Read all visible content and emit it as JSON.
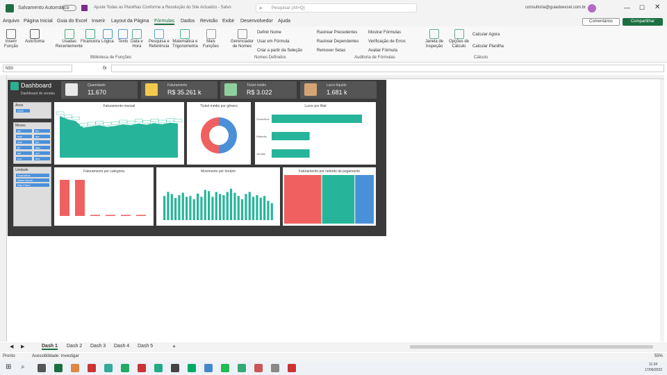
{
  "titlebar": {
    "autosave": "Salvamento Automático",
    "doc_title": "Ajuste Todas as Planilhas Conforme a Resolução do Site Actualizo - Salvo",
    "search": "Pesquisar (Alt+Q)",
    "user": "consultoria@guiadoexcel.com.br"
  },
  "menu": [
    "Arquivo",
    "Página Inicial",
    "Guia do Excel",
    "Inserir",
    "Layout da Página",
    "Fórmulas",
    "Dados",
    "Revisão",
    "Exibir",
    "Desenvolvedor",
    "Ajuda"
  ],
  "active_menu": "Fórmulas",
  "buttons": {
    "comments": "Comentários",
    "share": "Compartilhar"
  },
  "ribbon": {
    "items": [
      {
        "label": "Inserir\nFunção"
      },
      {
        "label": "AutoSoma"
      },
      {
        "label": "Usadas\nRecentemente"
      },
      {
        "label": "Financeira"
      },
      {
        "label": "Lógica"
      },
      {
        "label": "Texto"
      },
      {
        "label": "Data e\nHora"
      },
      {
        "label": "Pesquisa e\nReferência"
      },
      {
        "label": "Matemática e\nTrigonometria"
      },
      {
        "label": "Mais\nFunções"
      },
      {
        "label": "Gerenciador\nde Nomes"
      }
    ],
    "small": [
      "Definir Nome",
      "Usar em Fórmula",
      "Criar a partir da Seleção",
      "Rastrear Precedentes",
      "Rastrear Dependentes",
      "Remover Setas",
      "Mostrar Fórmulas",
      "Verificação de Erros",
      "Avaliar Fórmula",
      "Calcular Agora",
      "Calcular Planilha"
    ],
    "big2": [
      {
        "label": "Janela de\nInspeção"
      },
      {
        "label": "Opções de\nCálculo"
      }
    ],
    "groups": [
      "Biblioteca de Funções",
      "Nomes Definidos",
      "Auditoria de Fórmulas",
      "Cálculo"
    ]
  },
  "formula": {
    "namebox": "N50",
    "fx": "fx"
  },
  "dashboard": {
    "title": "Dashboard",
    "subtitle": "Dashboard de vendas",
    "kpis": [
      {
        "label": "Quantidade",
        "value": "11.670",
        "color": "#e8e8e8"
      },
      {
        "label": "Faturamento",
        "value": "R$ 35.261 k",
        "color": "#f2c94c"
      },
      {
        "label": "Ticket médio",
        "value": "R$ 3.022",
        "color": "#8fd19e"
      },
      {
        "label": "Lucro líquido",
        "value": "1.681 k",
        "color": "#d4a574"
      }
    ],
    "slicers": [
      {
        "title": "Anos",
        "items": [
          "2022"
        ]
      },
      {
        "title": "Meses",
        "items": [
          "jan",
          "fev",
          "mar",
          "abr",
          "mai",
          "jun",
          "jul",
          "ago",
          "set",
          "out",
          "nov",
          "dez"
        ]
      },
      {
        "title": "Unidade",
        "items": [
          "Guarulhos",
          "Santo André",
          "São Paulo"
        ]
      }
    ]
  },
  "charts": {
    "fat_mensal": {
      "title": "Faturamento mensal",
      "type": "area",
      "values": [
        100,
        92,
        88,
        72,
        75,
        78,
        74,
        76,
        80,
        78,
        82,
        79,
        83,
        80,
        84,
        82
      ]
    },
    "ticket": {
      "title": "Ticket médio por gênero",
      "type": "pie",
      "values": [
        50,
        50
      ],
      "colors": [
        "#4a90d9",
        "#f06060"
      ]
    },
    "lucro": {
      "title": "Lucro por filial",
      "type": "bar",
      "categories": [
        "Guarulhos",
        "Ribeirão",
        "Jundiaí"
      ],
      "values": [
        100,
        42,
        42
      ]
    },
    "fat_cat": {
      "title": "Faturamento por categoria",
      "type": "bar",
      "values": [
        100,
        100,
        3,
        3,
        3,
        3
      ]
    },
    "mov_hora": {
      "title": "Movimento por horário",
      "type": "bar",
      "values": [
        60,
        70,
        65,
        55,
        62,
        68,
        58,
        60,
        52,
        66,
        58,
        75,
        72,
        58,
        70,
        65,
        62,
        70,
        78,
        68,
        60,
        52,
        65,
        70,
        58,
        62,
        56,
        60,
        48,
        42
      ]
    },
    "fat_pag": {
      "title": "Faturamento por método de pagamento",
      "type": "treemap",
      "values": [
        55,
        48,
        28
      ],
      "colors": [
        "#f06060",
        "#26b59a",
        "#4a90d9"
      ]
    }
  },
  "sheets": [
    "Dash 1",
    "Dash 2",
    "Dash 3",
    "Dash 4",
    "Dash 5"
  ],
  "active_sheet": "Dash 1",
  "status": {
    "ready": "Pronto",
    "access": "Acessibilidade: Investigar",
    "zoom": "55%",
    "time": "11:34",
    "date": "17/06/2022"
  }
}
